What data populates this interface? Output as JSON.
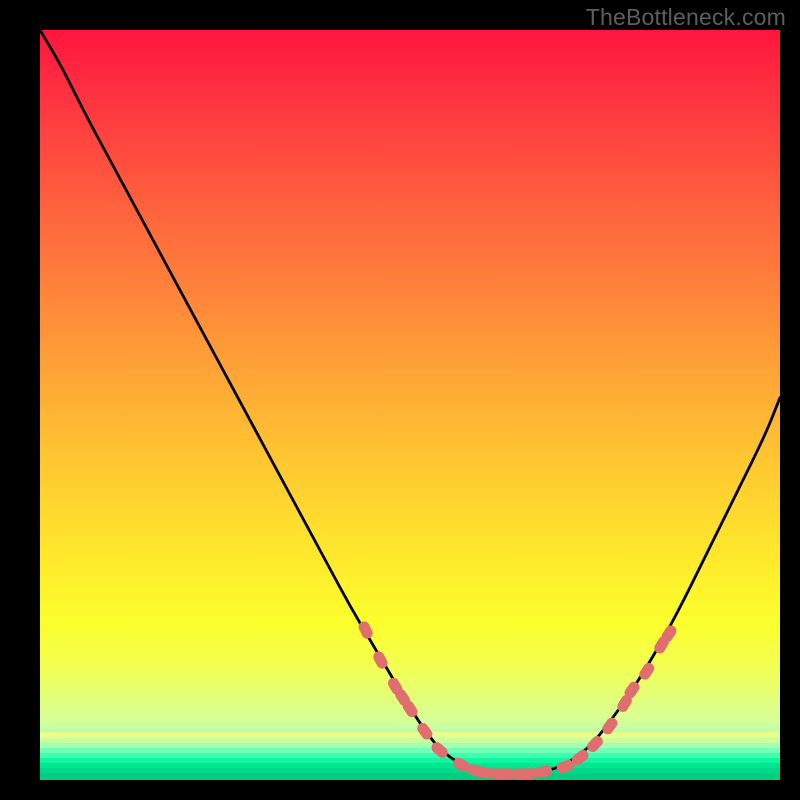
{
  "watermark": "TheBottleneck.com",
  "colors": {
    "page_bg": "#000000",
    "curve_stroke": "#000000",
    "marker_fill": "#e06e6e",
    "gradient_stops": [
      "#ff153d",
      "#ff2940",
      "#ff5d3e",
      "#ff8d39",
      "#ffbd32",
      "#ffe82c",
      "#fbff2d",
      "#f2ff52",
      "#d7ff97",
      "#8fffc1",
      "#00ff99",
      "#00db86"
    ]
  },
  "chart_data": {
    "type": "line",
    "title": "",
    "xlabel": "",
    "ylabel": "",
    "xlim": [
      0,
      100
    ],
    "ylim": [
      0,
      100
    ],
    "curve": {
      "name": "bottleneck-curve",
      "x": [
        0,
        3,
        6,
        9,
        12,
        15,
        18,
        21,
        24,
        27,
        30,
        33,
        36,
        39,
        42,
        45,
        48,
        51,
        54,
        57,
        60,
        63,
        66,
        70,
        74,
        78,
        82,
        86,
        90,
        94,
        98,
        100
      ],
      "y": [
        100,
        95,
        89,
        83.5,
        78,
        72.5,
        67,
        61.5,
        56,
        50.5,
        45,
        39.5,
        34,
        28.5,
        23,
        18,
        13,
        8,
        4,
        2,
        1,
        0.8,
        0.8,
        1.5,
        4,
        9,
        15,
        22,
        30,
        38,
        46,
        51
      ]
    },
    "markers": {
      "name": "highlighted-points",
      "x": [
        44,
        46,
        48,
        49,
        50,
        52,
        54,
        57,
        59,
        60,
        62,
        63,
        65,
        66,
        68,
        71,
        73,
        75,
        77,
        79,
        80,
        82,
        84,
        85
      ],
      "y": [
        20,
        16,
        12.5,
        11,
        9.5,
        6.5,
        4,
        2,
        1.2,
        1,
        0.8,
        0.8,
        0.8,
        0.8,
        1.1,
        1.8,
        3,
        4.8,
        7.2,
        10.2,
        12,
        14.5,
        18,
        19.5
      ]
    }
  }
}
